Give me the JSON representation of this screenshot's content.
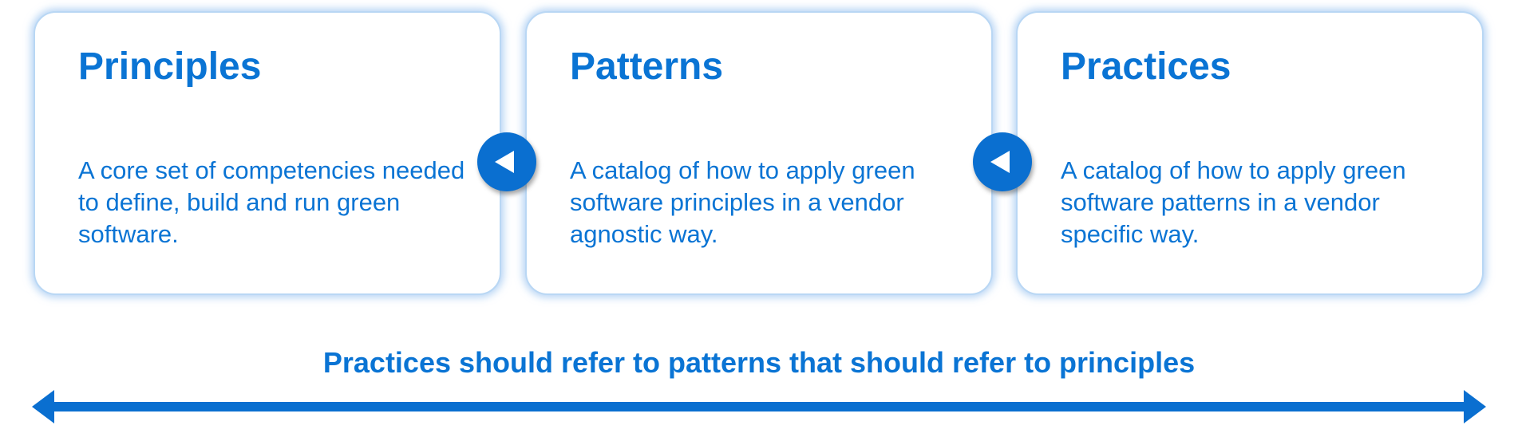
{
  "cards": [
    {
      "title": "Principles",
      "description": "A core set of competencies needed to define, build and run green software."
    },
    {
      "title": "Patterns",
      "description": "A catalog of how to apply green software principles in a vendor agnostic way."
    },
    {
      "title": "Practices",
      "description": "A catalog of how to apply green software patterns in a vendor specific way."
    }
  ],
  "connectors": [
    {
      "icon": "left-arrow-icon"
    },
    {
      "icon": "left-arrow-icon"
    }
  ],
  "caption": "Practices should refer to patterns that should refer to principles",
  "colors": {
    "accent": "#0a74d4",
    "connector": "#0a6fd0",
    "card_border": "#b9d7f4"
  }
}
